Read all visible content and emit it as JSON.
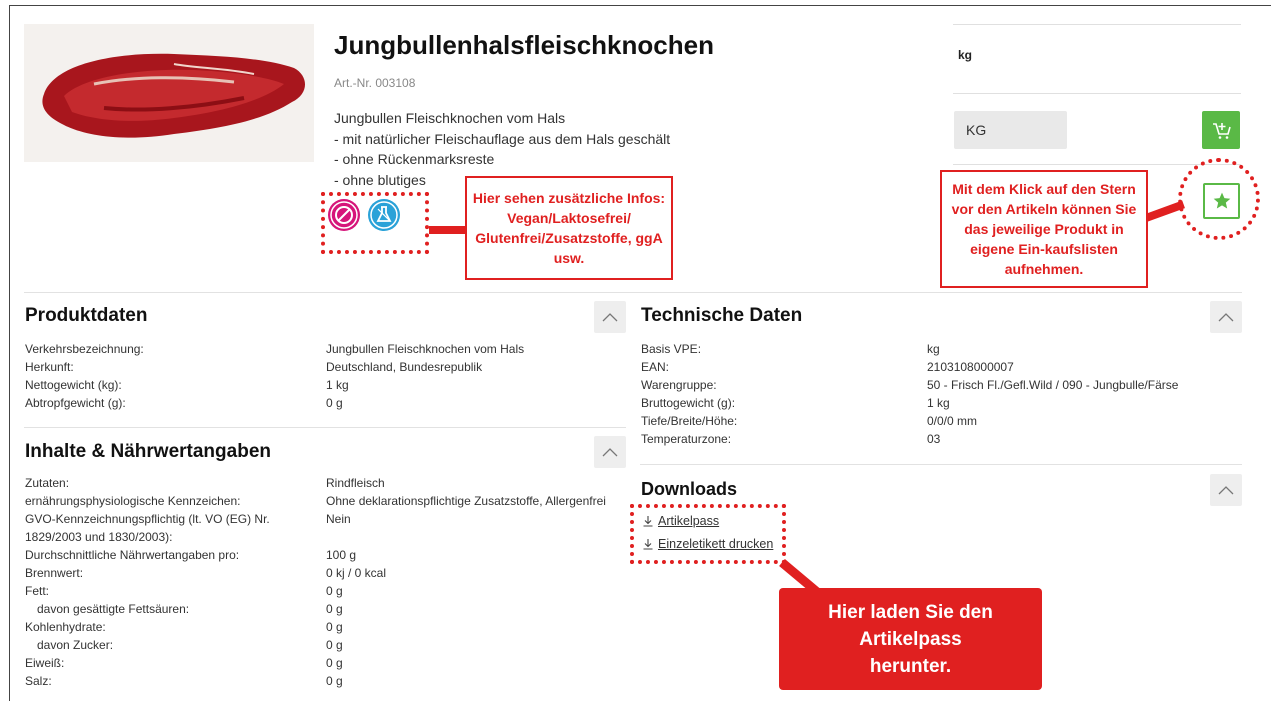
{
  "product": {
    "title": "Jungbullenhalsfleischknochen",
    "artnr": "Art.-Nr. 003108",
    "description": [
      "Jungbullen Fleischknochen vom Hals",
      "- mit natürlicher Fleischauflage aus dem Hals geschält",
      "- ohne Rückenmarksreste",
      "- ohne blutiges"
    ]
  },
  "purchase": {
    "unit_label": "kg",
    "unit_select": "KG"
  },
  "callouts": {
    "badges": "Hier sehen zusätzliche Infos: Vegan/Laktosefrei/ Glutenfrei/Zusatzstoffe, ggA usw.",
    "star": "Mit dem Klick auf den Stern vor den Artikeln können Sie das jeweilige Produkt in eigene Ein-kaufslisten aufnehmen.",
    "downloads": "Hier laden Sie den Artikelpass herunter."
  },
  "produktdaten": {
    "heading": "Produktdaten",
    "rows": [
      {
        "label": "Verkehrsbezeichnung:",
        "value": "Jungbullen Fleischknochen vom Hals"
      },
      {
        "label": "Herkunft:",
        "value": "Deutschland, Bundesrepublik"
      },
      {
        "label": "Nettogewicht (kg):",
        "value": "1 kg"
      },
      {
        "label": "Abtropfgewicht (g):",
        "value": "0 g"
      }
    ]
  },
  "inhalte": {
    "heading": "Inhalte & Nährwertangaben",
    "rows": [
      {
        "label": "Zutaten:",
        "value": "Rindfleisch"
      },
      {
        "label": "ernährungsphysiologische Kennzeichen:",
        "value": "Ohne deklarationspflichtige Zusatzstoffe, Allergenfrei"
      },
      {
        "label": "GVO-Kennzeichnungspflichtig (lt. VO (EG) Nr. 1829/2003 und 1830/2003):",
        "value": "Nein"
      },
      {
        "label": "Durchschnittliche Nährwertangaben pro:",
        "value": "100 g"
      },
      {
        "label": "Brennwert:",
        "value": "0 kj / 0 kcal"
      },
      {
        "label": "Fett:",
        "value": "0 g"
      },
      {
        "label": "davon gesättigte Fettsäuren:",
        "value": "0 g"
      },
      {
        "label": "Kohlenhydrate:",
        "value": "0 g"
      },
      {
        "label": "davon Zucker:",
        "value": "0 g"
      },
      {
        "label": "Eiweiß:",
        "value": "0 g"
      },
      {
        "label": "Salz:",
        "value": "0 g"
      }
    ]
  },
  "technische": {
    "heading": "Technische Daten",
    "rows": [
      {
        "label": "Basis VPE:",
        "value": "kg"
      },
      {
        "label": "EAN:",
        "value": "2103108000007"
      },
      {
        "label": "Warengruppe:",
        "value": "50 - Frisch Fl./Gefl.Wild / 090 - Jungbulle/Färse"
      },
      {
        "label": "Bruttogewicht (g):",
        "value": "1 kg"
      },
      {
        "label": "Tiefe/Breite/Höhe:",
        "value": "0/0/0 mm"
      },
      {
        "label": "Temperaturzone:",
        "value": "03"
      }
    ]
  },
  "downloads": {
    "heading": "Downloads",
    "links": [
      "Artikelpass",
      "Einzeletikett drucken"
    ]
  },
  "icons": {
    "badge_1": "no-allergen-icon",
    "badge_2": "lab-flask-icon",
    "cart": "add-to-cart-icon",
    "star": "star-icon",
    "toggle": "chevron-up-icon",
    "download": "download-icon"
  },
  "colors": {
    "accent_green": "#5ab946",
    "annotation_red": "#e02020",
    "badge_magenta": "#d6157a",
    "badge_blue": "#2aa2d8"
  }
}
